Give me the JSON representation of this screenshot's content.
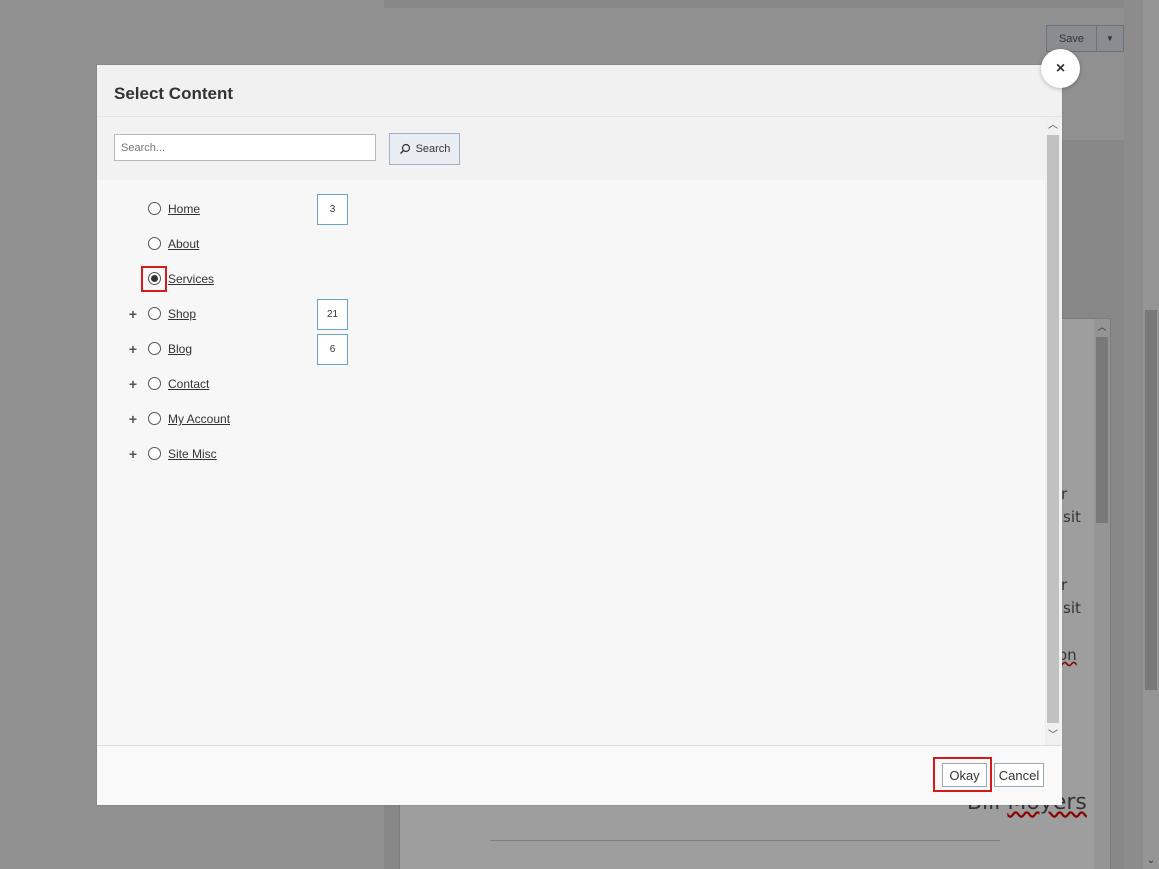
{
  "background": {
    "save_label": "Save",
    "editor_text": [
      "r",
      "sit",
      "r",
      "sit",
      "on"
    ],
    "quote_prefix": "- Bill ",
    "quote_name": "Moyers"
  },
  "modal": {
    "title": "Select Content",
    "close_icon": "×",
    "search": {
      "placeholder": "Search...",
      "value": "",
      "button_label": "Search"
    },
    "tree": [
      {
        "label": "Home",
        "count": "3",
        "expandable": false,
        "selected": false
      },
      {
        "label": "About",
        "count": null,
        "expandable": false,
        "selected": false
      },
      {
        "label": "Services",
        "count": null,
        "expandable": false,
        "selected": true
      },
      {
        "label": "Shop",
        "count": "21",
        "expandable": true,
        "selected": false
      },
      {
        "label": "Blog",
        "count": "6",
        "expandable": true,
        "selected": false
      },
      {
        "label": "Contact",
        "count": null,
        "expandable": true,
        "selected": false
      },
      {
        "label": "My Account",
        "count": null,
        "expandable": true,
        "selected": false
      },
      {
        "label": "Site Misc",
        "count": null,
        "expandable": true,
        "selected": false
      }
    ],
    "expander_glyph": "+",
    "footer": {
      "okay_label": "Okay",
      "cancel_label": "Cancel"
    }
  },
  "colors": {
    "highlight": "#d21b1b",
    "badge_border": "#6aa3c4",
    "overlay": "rgba(0,0,0,0.38)"
  }
}
